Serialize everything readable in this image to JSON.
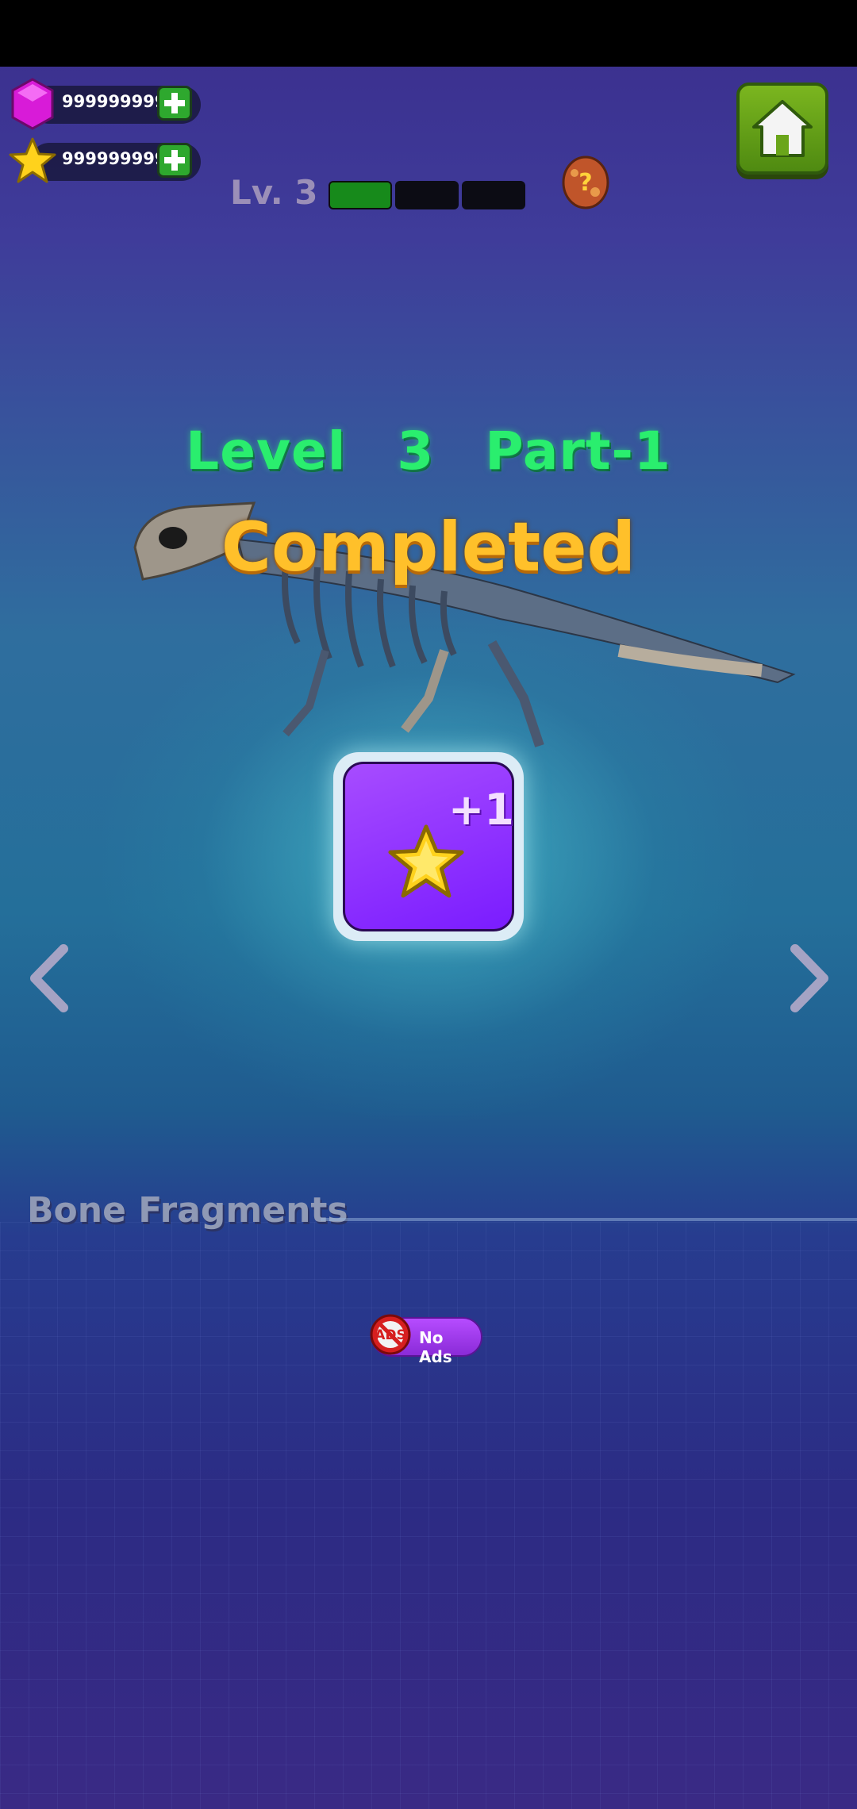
{
  "currency": {
    "gems": {
      "value": "999999999",
      "icon": "gem-icon"
    },
    "stars": {
      "value": "999999999",
      "icon": "star-icon"
    }
  },
  "level": {
    "label": "Lv. 3",
    "progress_segments_filled": 1,
    "progress_segments_total": 3
  },
  "headline": {
    "level": "Level 3",
    "part": "Part-1",
    "status": "Completed"
  },
  "reward": {
    "amount": "+1",
    "icon": "star-icon"
  },
  "section": {
    "title": "Bone Fragments"
  },
  "no_ads": {
    "icon_text": "ADS",
    "label": "No Ads"
  },
  "colors": {
    "accent_green": "#2aee6e",
    "completed_gold": "#ffc02a",
    "home_green": "#6aa51a"
  }
}
